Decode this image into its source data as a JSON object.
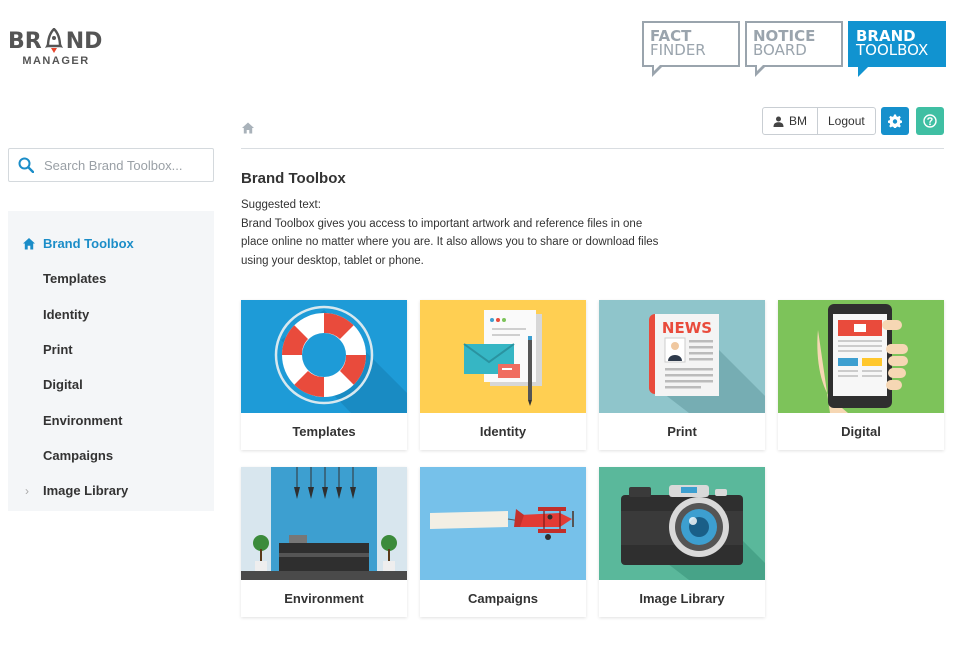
{
  "brand": {
    "logo_top": "BRAND",
    "logo_sub": "MANAGER"
  },
  "apps": [
    {
      "line1": "FACT",
      "line2": "FINDER",
      "active": false
    },
    {
      "line1": "NOTICE",
      "line2": "BOARD",
      "active": false
    },
    {
      "line1": "BRAND",
      "line2": "TOOLBOX",
      "active": true
    }
  ],
  "search": {
    "placeholder": "Search Brand Toolbox..."
  },
  "sidebar": {
    "items": [
      {
        "label": "Brand Toolbox",
        "active": true,
        "icon": "home-icon"
      },
      {
        "label": "Templates"
      },
      {
        "label": "Identity"
      },
      {
        "label": "Print"
      },
      {
        "label": "Digital"
      },
      {
        "label": "Environment"
      },
      {
        "label": "Campaigns"
      },
      {
        "label": "Image Library",
        "icon": "chevron-right-icon"
      }
    ]
  },
  "header": {
    "user_initials": "BM",
    "logout_label": "Logout",
    "gear_color": "#1690cc",
    "help_color": "#3fbfa3"
  },
  "main": {
    "title": "Brand Toolbox",
    "desc_label": "Suggested text:",
    "desc_line1": "Brand Toolbox gives you access to important artwork and reference files in one",
    "desc_line2": "place online no matter where you are. It also allows you to share or download files",
    "desc_line3": "using your desktop, tablet or phone.",
    "cards": [
      {
        "label": "Templates",
        "icon": "life-ring-icon",
        "color": "#1e9bd7"
      },
      {
        "label": "Identity",
        "icon": "stationery-icon",
        "color": "#ffcf52"
      },
      {
        "label": "Print",
        "icon": "newspaper-icon",
        "color": "#8fc5cb"
      },
      {
        "label": "Digital",
        "icon": "smartphone-icon",
        "color": "#7dc35a"
      },
      {
        "label": "Environment",
        "icon": "reception-desk-icon",
        "color": "#3d9fd0"
      },
      {
        "label": "Campaigns",
        "icon": "airplane-banner-icon",
        "color": "#76c1ea"
      },
      {
        "label": "Image Library",
        "icon": "camera-icon",
        "color": "#5ab89b"
      }
    ]
  },
  "colors": {
    "accent": "#1193d0",
    "nav_active": "#1b8dc8",
    "app_border": "#9aa4ad"
  }
}
